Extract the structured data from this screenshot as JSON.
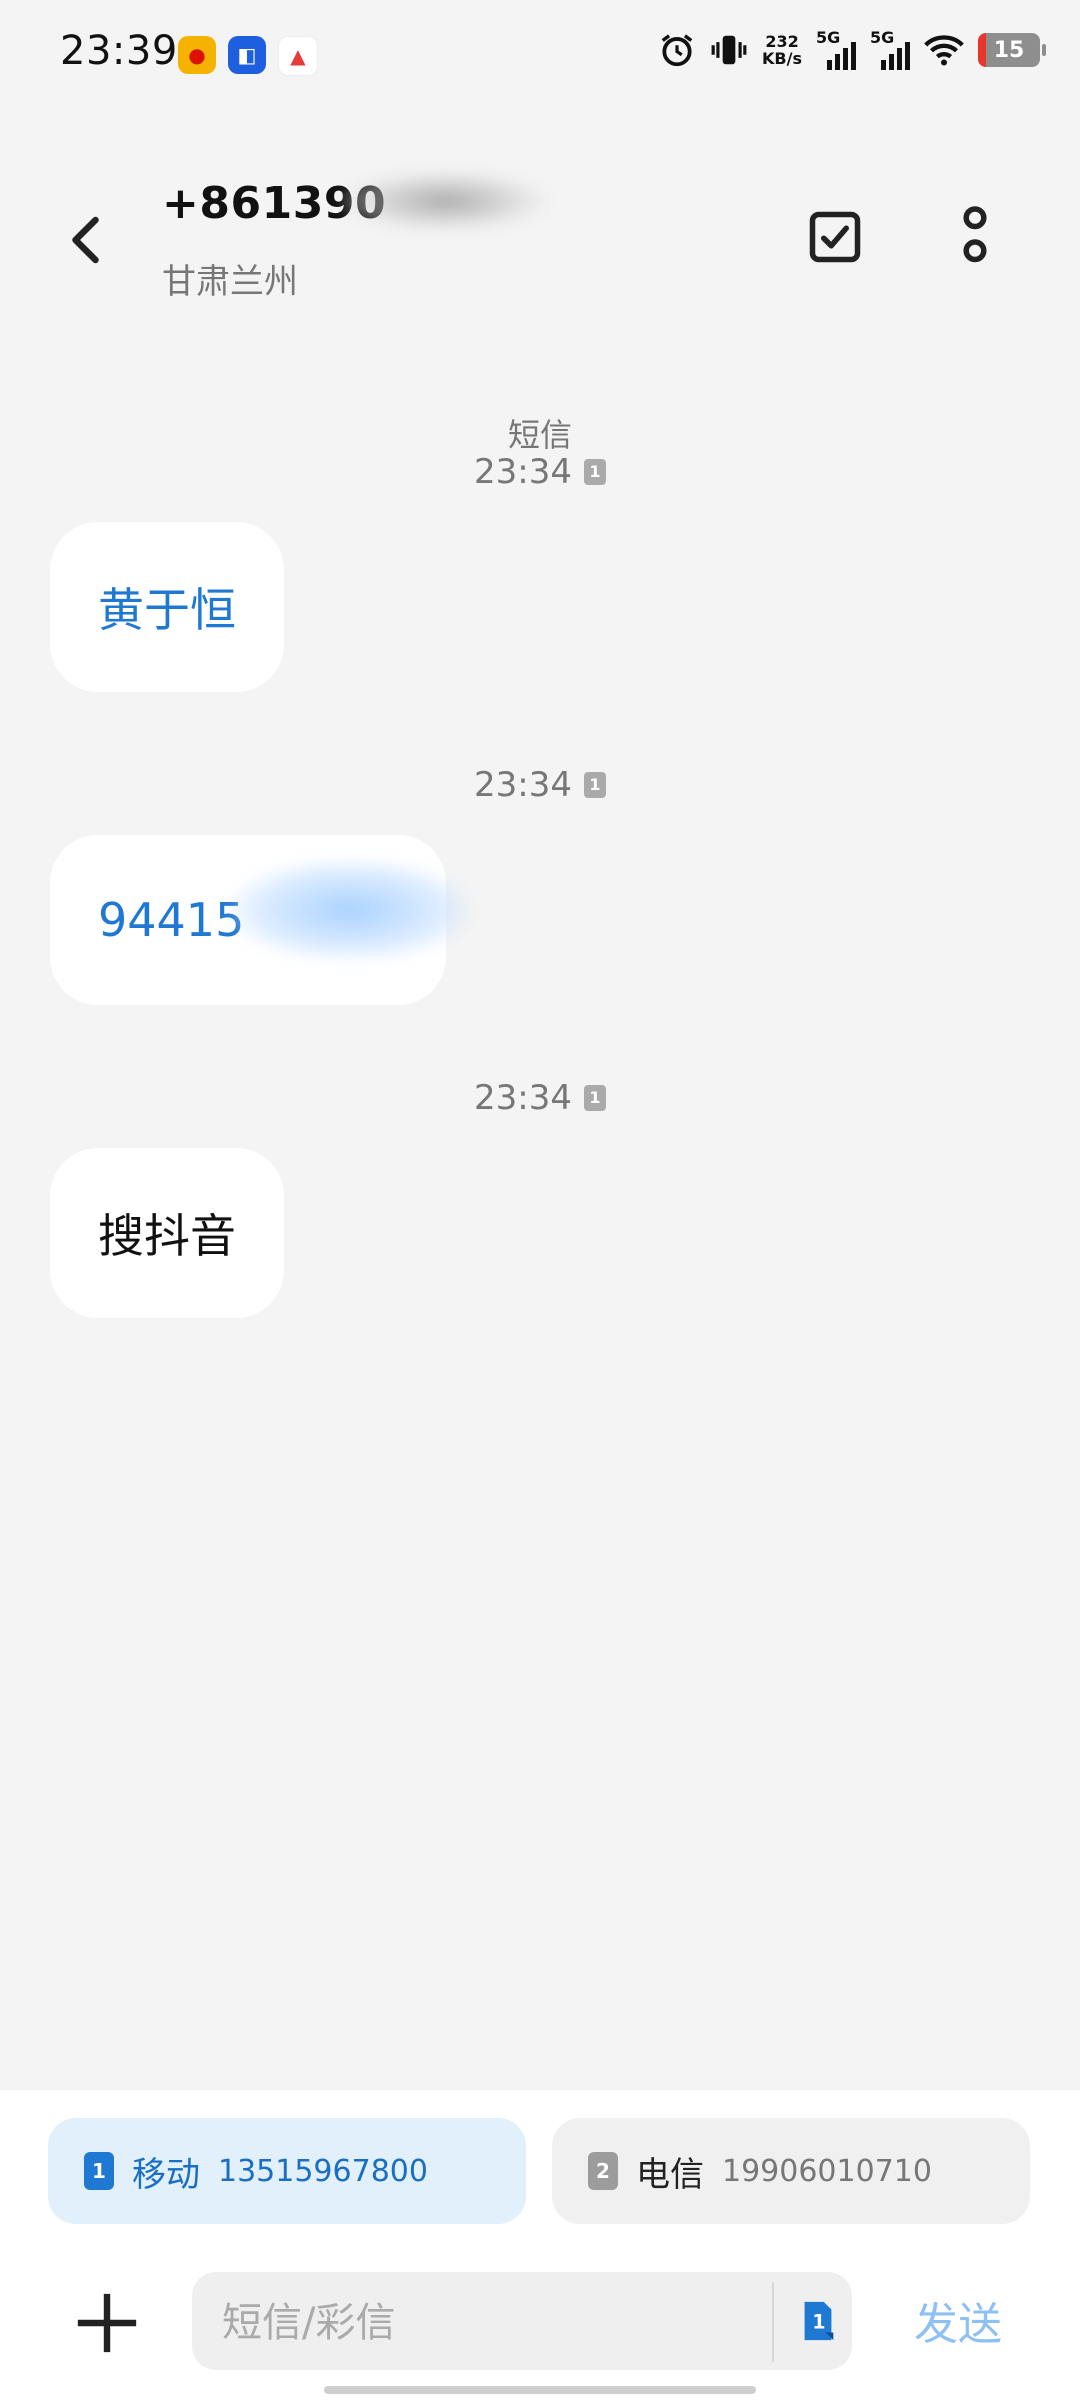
{
  "status_bar": {
    "time": "23:39",
    "net_speed_value": "232",
    "net_speed_unit": "KB/s",
    "sim1_label": "5G",
    "sim2_label": "5G",
    "battery": "15"
  },
  "header": {
    "number": "+861390",
    "region": "甘肃兰州"
  },
  "messages": {
    "channel_label": "短信",
    "items": [
      {
        "time": "23:34",
        "sim": "1",
        "text": "黄于恒"
      },
      {
        "time": "23:34",
        "sim": "1",
        "text": "94415"
      },
      {
        "time": "23:34",
        "sim": "1",
        "text": "搜抖音"
      }
    ]
  },
  "sim_selector": {
    "sim1": {
      "index": "1",
      "carrier": "移动",
      "number": "13515967800"
    },
    "sim2": {
      "index": "2",
      "carrier": "电信",
      "number": "19906010710"
    }
  },
  "composer": {
    "placeholder": "短信/彩信",
    "send_label": "发送"
  },
  "colors": {
    "accent": "#1f78d1",
    "background": "#f4f4f4",
    "send_disabled": "#8fc0f4"
  },
  "icons": {
    "back": "back-arrow-icon",
    "select": "checkbox-icon",
    "more": "more-vertical-icon",
    "attach": "plus-icon",
    "sim_switch": "sim-card-icon"
  }
}
